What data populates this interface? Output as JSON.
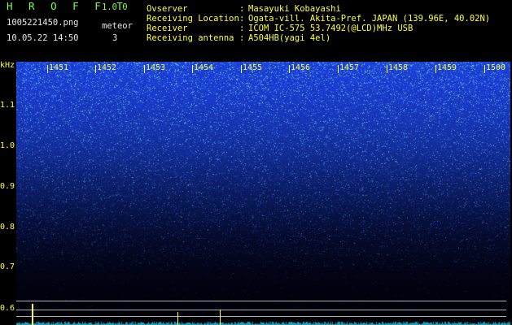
{
  "header": {
    "app_title": "H R O F F T",
    "app_version": "1.0.0",
    "filename": "1005221450.png",
    "datetime": "10.05.22 14:50",
    "meteor_label": "meteor",
    "meteor_count": "3"
  },
  "info": [
    {
      "label": "Ovserver",
      "value": "Masayuki Kobayashi"
    },
    {
      "label": "Receiving Location",
      "value": "Ogata-vill. Akita-Pref. JAPAN (139.96E, 40.02N)"
    },
    {
      "label": "Receiver",
      "value": "ICOM IC-575 53.7492(@LCD)MHz USB"
    },
    {
      "label": "Receiving antenna",
      "value": "A504HB(yagi 4el)"
    }
  ],
  "time_ticks": [
    "1451",
    "1452",
    "1453",
    "1454",
    "1455",
    "1456",
    "1457",
    "1458",
    "1459",
    "1500"
  ],
  "freq_axis": {
    "unit": "kHz",
    "labels": [
      "1.1",
      "1.0",
      "0.9",
      "0.8",
      "0.7",
      "0.6"
    ]
  },
  "colors": {
    "label_green": "#7dff4f",
    "axis_yellow": "#ffff40",
    "spectrogram_blue": "#1b3fe6"
  }
}
